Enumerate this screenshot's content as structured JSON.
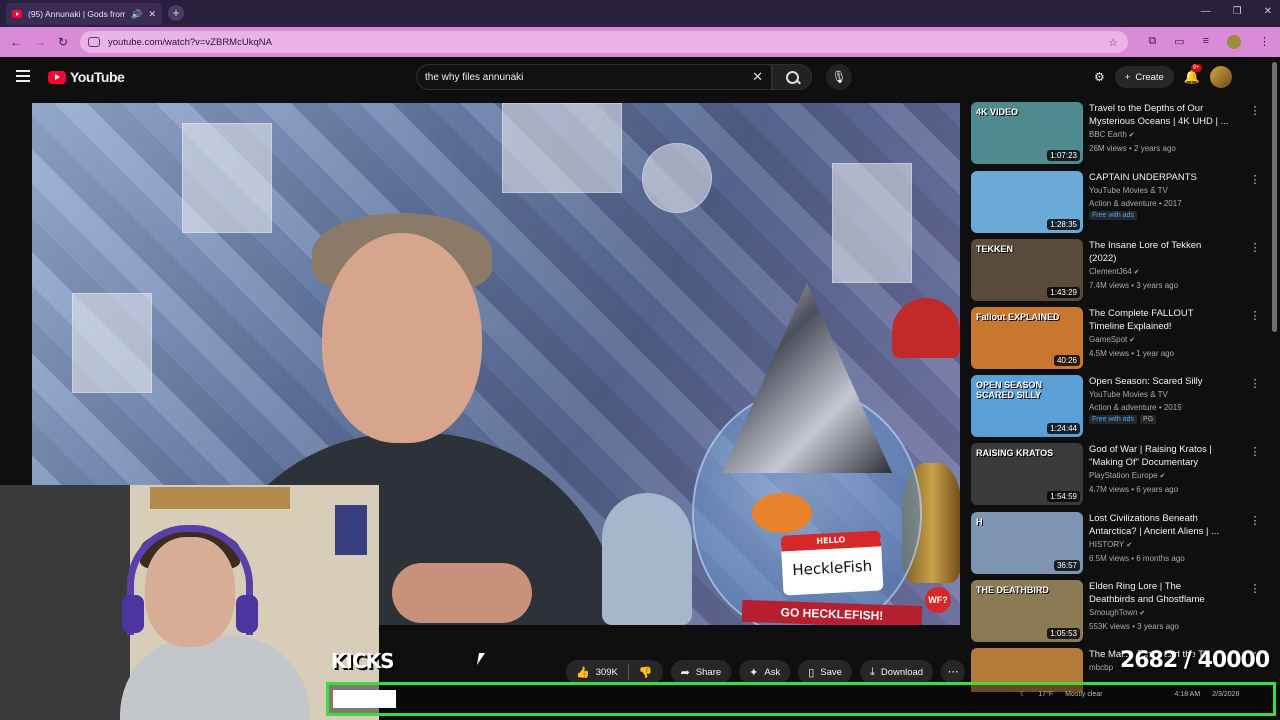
{
  "browser": {
    "tab_title": "(95) Annunaki | Gods from O...",
    "new_tab": "+",
    "url": "youtube.com/watch?v=vZBRMcUkqNA",
    "window_controls": [
      "—",
      "❐",
      "✕"
    ]
  },
  "youtube": {
    "logo_text": "YouTube",
    "search_query": "the why files annunaki",
    "create_label": "Create",
    "notifications_badge": "9+"
  },
  "video": {
    "name_tag_hello": "HELLO",
    "name_tag_text": "HeckleFish",
    "banner_text": "GO HECKLEFISH!",
    "channel_bug": "WF?"
  },
  "actions": {
    "like_count": "309K",
    "share": "Share",
    "ask": "Ask",
    "save": "Save",
    "download": "Download"
  },
  "recommendations": [
    {
      "title": "Travel to the Depths of Our Mysterious Oceans | 4K UHD | ...",
      "channel": "BBC Earth",
      "verified": true,
      "stats": "26M views • 2 years ago",
      "duration": "1:07:23",
      "thumb_color": "#4f8a8f",
      "thumb_label": "4K VIDEO"
    },
    {
      "title": "CAPTAIN UNDERPANTS",
      "channel": "YouTube Movies & TV",
      "verified": false,
      "stats": "Action & adventure • 2017",
      "duration": "1:28:35",
      "thumb_color": "#6aa9d8",
      "badges": [
        "Free with ads"
      ]
    },
    {
      "title": "The Insane Lore of Tekken (2022)",
      "channel": "ClementJ64",
      "verified": true,
      "stats": "7.4M views • 3 years ago",
      "duration": "1:43:29",
      "thumb_color": "#5a4a3c",
      "thumb_label": "TEKKEN"
    },
    {
      "title": "The Complete FALLOUT Timeline Explained!",
      "channel": "GameSpot",
      "verified": true,
      "stats": "4.5M views • 1 year ago",
      "duration": "40:26",
      "thumb_color": "#c9762e",
      "thumb_label": "Fallout EXPLAINED"
    },
    {
      "title": "Open Season: Scared Silly",
      "channel": "YouTube Movies & TV",
      "verified": false,
      "stats": "Action & adventure • 2015",
      "duration": "1:24:44",
      "thumb_color": "#5aa0d6",
      "thumb_label": "OPEN SEASON SCARED SILLY",
      "badges": [
        "Free with ads",
        "PG"
      ]
    },
    {
      "title": "God of War | Raising Kratos | \"Making Of\" Documentary",
      "channel": "PlayStation Europe",
      "verified": true,
      "stats": "4.7M views • 6 years ago",
      "duration": "1:54:59",
      "thumb_color": "#3c3a38",
      "thumb_label": "RAISING KRATOS"
    },
    {
      "title": "Lost Civilizations Beneath Antarctica? | Ancient Aliens | ...",
      "channel": "HISTORY",
      "verified": true,
      "stats": "6.5M views • 6 months ago",
      "duration": "36:57",
      "thumb_color": "#7d95b2",
      "thumb_label": "H"
    },
    {
      "title": "Elden Ring Lore | The Deathbirds and Ghostflame",
      "channel": "SmoughTown",
      "verified": true,
      "stats": "553K views • 3 years ago",
      "duration": "1:05:53",
      "thumb_color": "#8c7a55",
      "thumb_label": "THE DEATHBIRD"
    },
    {
      "title": "The Mall... Jones and the T...",
      "channel": "mbcbp",
      "verified": false,
      "stats": "",
      "duration": "",
      "thumb_color": "#b37a3a"
    }
  ],
  "overlay": {
    "kicks_label": "KICKS",
    "counter": "2682 / 40000",
    "goal_progress": 0.067,
    "tray_weather": "17°F",
    "tray_weather_desc": "Mostly clear",
    "tray_time": "4:18 AM",
    "tray_date": "2/3/2026"
  },
  "colors": {
    "yt_red": "#ff0033",
    "addr_bar": "#d98bd8",
    "goal_border": "#3ddc3d"
  }
}
